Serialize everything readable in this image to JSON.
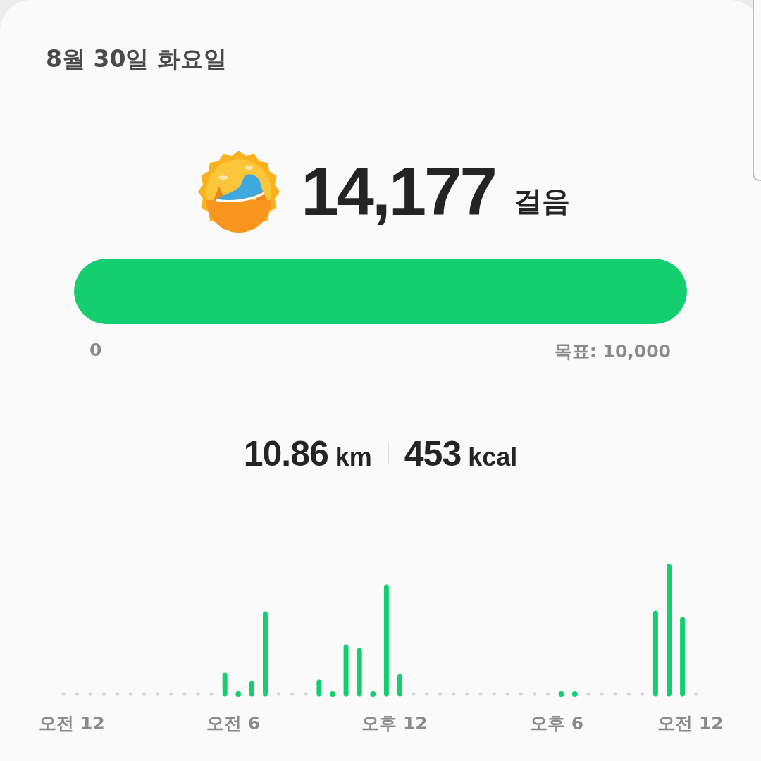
{
  "date": "8월 30일 화요일",
  "steps": {
    "count": "14,177",
    "unit": "걸음"
  },
  "progress": {
    "level": 1,
    "start_label": "0",
    "goal_label": "목표: 10,000"
  },
  "stats": [
    {
      "value": "10.86",
      "unit": "km"
    },
    {
      "value": "453",
      "unit": "kcal"
    }
  ],
  "chart": {
    "x_labels": [
      "오전 12",
      "오전 6",
      "오후 12",
      "오후 6",
      "오전 12"
    ]
  }
}
